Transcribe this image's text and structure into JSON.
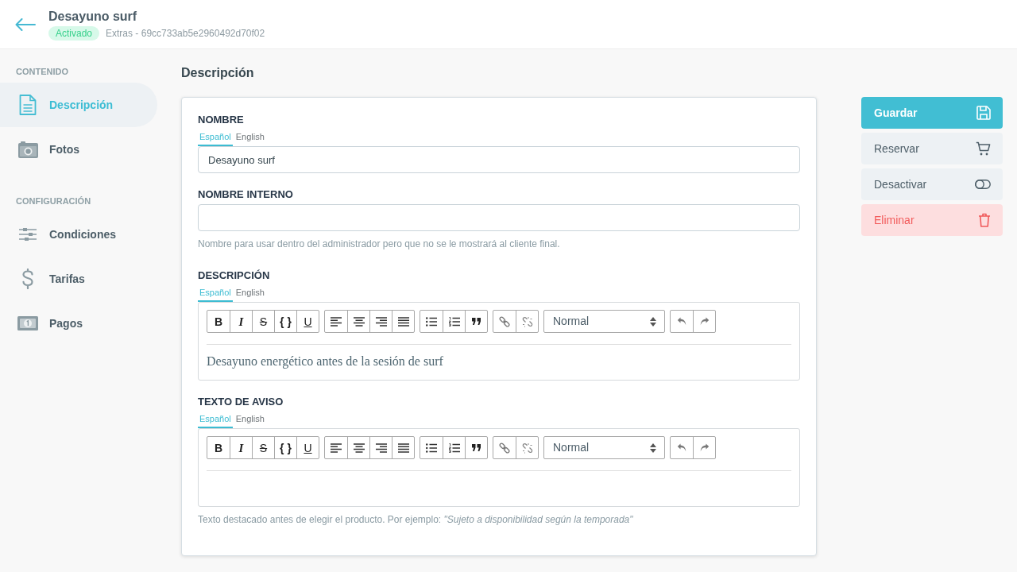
{
  "header": {
    "title": "Desayuno surf",
    "status": "Activado",
    "subtitle": "Extras - 69cc733ab5e2960492d70f02"
  },
  "sidebar": {
    "sections": [
      {
        "heading": "CONTENIDO",
        "items": [
          {
            "kind": "document",
            "label": "Descripción",
            "selected": true
          },
          {
            "kind": "camera",
            "label": "Fotos",
            "selected": false
          }
        ]
      },
      {
        "heading": "CONFIGURACIÓN",
        "items": [
          {
            "kind": "sliders",
            "label": "Condiciones",
            "selected": false
          },
          {
            "kind": "dollar",
            "label": "Tarifas",
            "selected": false
          },
          {
            "kind": "banknote",
            "label": "Pagos",
            "selected": false
          }
        ]
      }
    ]
  },
  "page_title": "Descripción",
  "form": {
    "fields": [
      {
        "kind": "text",
        "label": "NOMBRE",
        "languages": [
          {
            "label": "Español",
            "selected": true
          },
          {
            "label": "English",
            "selected": false
          }
        ],
        "value": "Desayuno surf"
      },
      {
        "kind": "text",
        "label": "NOMBRE INTERNO",
        "hint": "Nombre para usar dentro del administrador pero que no se le mostrará al cliente final."
      },
      {
        "kind": "editor",
        "label": "DESCRIPCIÓN",
        "languages": [
          {
            "label": "Español",
            "selected": true
          },
          {
            "label": "English",
            "selected": false
          }
        ],
        "toolbar": [
          [
            {
              "kind": "bold",
              "label": "B"
            },
            {
              "kind": "italic",
              "label": "I"
            },
            {
              "kind": "strike",
              "label": "S"
            },
            {
              "kind": "code",
              "label": "{ }"
            },
            {
              "kind": "underline",
              "label": "U"
            }
          ],
          [
            {
              "kind": "left"
            },
            {
              "kind": "center"
            },
            {
              "kind": "right"
            },
            {
              "kind": "justify"
            }
          ],
          [
            {
              "kind": "bullets"
            },
            {
              "kind": "numbers"
            },
            {
              "kind": "quote"
            }
          ],
          [
            {
              "kind": "link"
            },
            {
              "kind": "unlink"
            }
          ],
          [
            {
              "kind": "select",
              "value": "Normal"
            }
          ],
          [
            {
              "kind": "undo"
            },
            {
              "kind": "redo"
            }
          ]
        ],
        "value": "Desayuno energético antes de la sesión de surf"
      },
      {
        "kind": "editor",
        "label": "TEXTO DE AVISO",
        "languages": [
          {
            "label": "Español",
            "selected": true
          },
          {
            "label": "English",
            "selected": false
          }
        ],
        "toolbar": [
          [
            {
              "kind": "bold",
              "label": "B"
            },
            {
              "kind": "italic",
              "label": "I"
            },
            {
              "kind": "strike",
              "label": "S"
            },
            {
              "kind": "code",
              "label": "{ }"
            },
            {
              "kind": "underline",
              "label": "U"
            }
          ],
          [
            {
              "kind": "left"
            },
            {
              "kind": "center"
            },
            {
              "kind": "right"
            },
            {
              "kind": "justify"
            }
          ],
          [
            {
              "kind": "bullets"
            },
            {
              "kind": "numbers"
            },
            {
              "kind": "quote"
            }
          ],
          [
            {
              "kind": "link"
            },
            {
              "kind": "unlink"
            }
          ],
          [
            {
              "kind": "select",
              "value": "Normal"
            }
          ],
          [
            {
              "kind": "undo"
            },
            {
              "kind": "redo"
            }
          ]
        ],
        "hint": "Texto destacado antes de elegir el producto. Por ejemplo: *\"Sujeto a disponibilidad según la temporada\"*"
      }
    ]
  },
  "actions": [
    {
      "kind": "save",
      "label": "Guardar"
    },
    {
      "kind": "book",
      "label": "Reservar"
    },
    {
      "kind": "deactivate",
      "label": "Desactivar"
    },
    {
      "kind": "delete",
      "label": "Eliminar"
    }
  ]
}
